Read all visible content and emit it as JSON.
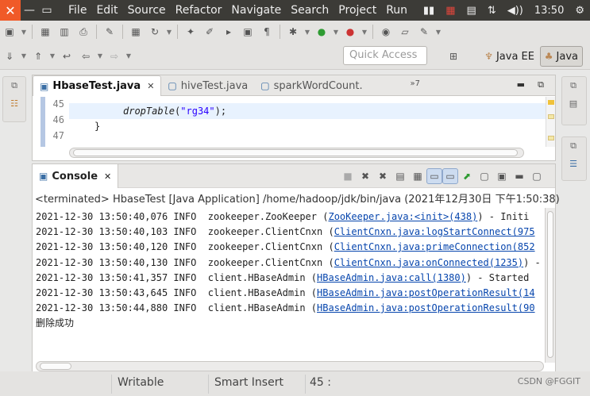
{
  "system_bar": {
    "close_glyph": "✕",
    "menu": [
      "File",
      "Edit",
      "Source",
      "Refactor",
      "Navigate",
      "Search",
      "Project",
      "Run"
    ],
    "clock": "13:50"
  },
  "toolbar": {
    "quick_access_placeholder": "Quick Access",
    "perspectives": [
      "Java EE",
      "Java"
    ]
  },
  "editor": {
    "tabs": [
      {
        "label": "HbaseTest.java",
        "active": true
      },
      {
        "label": "hiveTest.java",
        "active": false
      },
      {
        "label": "sparkWordCount.",
        "active": false
      }
    ],
    "more_tabs": "»7",
    "line_numbers": [
      "45",
      "46",
      "47"
    ],
    "code": {
      "method": "dropTable",
      "open": "(",
      "string": "\"rg34\"",
      "close": ");",
      "brace": "}"
    }
  },
  "console": {
    "tab_label": "Console",
    "terminated_label": "<terminated> HbaseTest [Java Application] /home/hadoop/jdk/bin/java (2021年12月30日 下午1:50:38)",
    "lines": [
      {
        "time": "2021-12-30 13:50:40,076",
        "level": "INFO",
        "logger": "zookeeper.ZooKeeper",
        "link": "ZooKeeper.java:<init>(438)",
        "suffix": ") - Initi"
      },
      {
        "time": "2021-12-30 13:50:40,103",
        "level": "INFO",
        "logger": "zookeeper.ClientCnxn",
        "link": "ClientCnxn.java:logStartConnect(975",
        "suffix": ""
      },
      {
        "time": "2021-12-30 13:50:40,120",
        "level": "INFO",
        "logger": "zookeeper.ClientCnxn",
        "link": "ClientCnxn.java:primeConnection(852",
        "suffix": ""
      },
      {
        "time": "2021-12-30 13:50:40,130",
        "level": "INFO",
        "logger": "zookeeper.ClientCnxn",
        "link": "ClientCnxn.java:onConnected(1235)",
        "suffix": ") -"
      },
      {
        "time": "2021-12-30 13:50:41,357",
        "level": "INFO",
        "logger": "client.HBaseAdmin",
        "link": "HBaseAdmin.java:call(1380)",
        "suffix": ") - Started"
      },
      {
        "time": "2021-12-30 13:50:43,645",
        "level": "INFO",
        "logger": "client.HBaseAdmin",
        "link": "HBaseAdmin.java:postOperationResult(14",
        "suffix": ""
      },
      {
        "time": "2021-12-30 13:50:44,880",
        "level": "INFO",
        "logger": "client.HBaseAdmin",
        "link": "HBaseAdmin.java:postOperationResult(90",
        "suffix": ""
      }
    ],
    "final_line": "删除成功"
  },
  "status_bar": {
    "writable": "Writable",
    "insert_mode": "Smart Insert",
    "position": "45 :",
    "watermark": "CSDN @FGGIT"
  }
}
